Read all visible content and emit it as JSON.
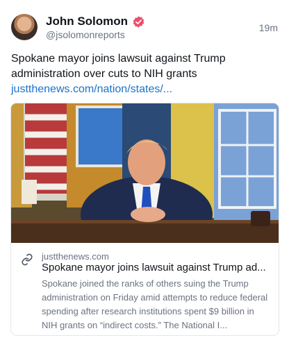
{
  "author": {
    "name": "John Solomon",
    "handle": "@jsolomonreports",
    "verified_color": "#ec4e6b"
  },
  "timestamp": "19m",
  "post": {
    "text": "Spokane mayor joins lawsuit against Trump administration over cuts to NIH grants",
    "link_text": "justthenews.com/nation/states/..."
  },
  "link_card": {
    "domain": "justthenews.com",
    "title": "Spokane mayor joins lawsuit against Trump ad...",
    "description": "Spokane joined the ranks of others suing the Trump administration on Friday amid attempts to reduce federal spending after research institutions spent $9 billion in NIH grants on “indirect costs.” The National I...",
    "icon": "link-icon"
  },
  "colors": {
    "link": "#1a73c9",
    "secondary_text": "#6b7280"
  }
}
